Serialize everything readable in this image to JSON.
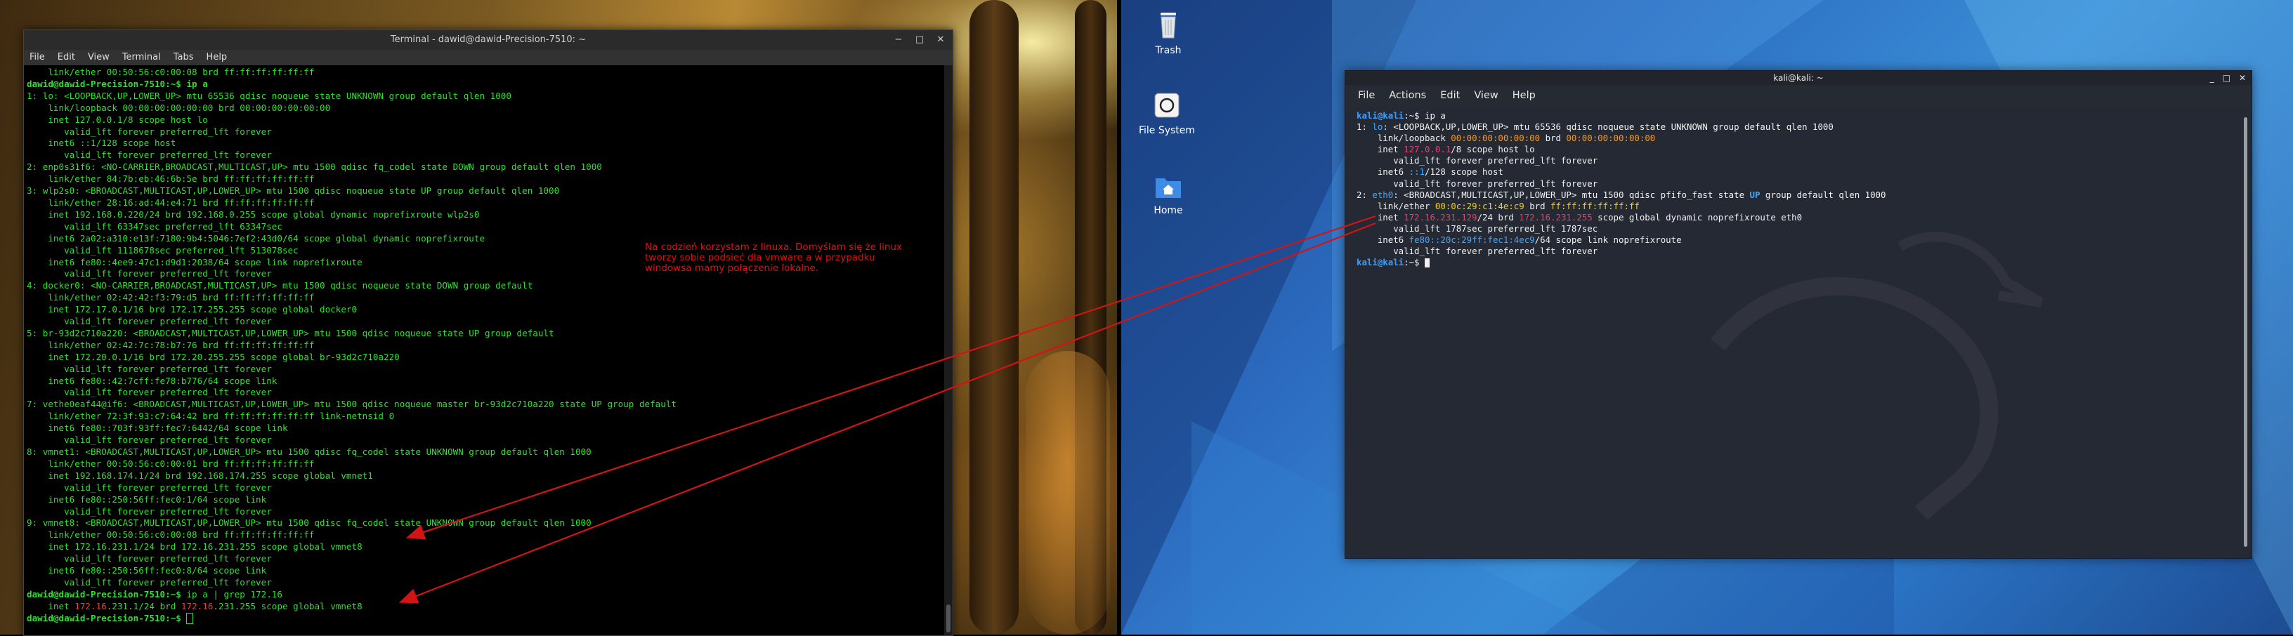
{
  "left_terminal": {
    "title": "Terminal - dawid@dawid-Precision-7510: ~",
    "window_buttons": [
      "−",
      "□",
      "✕"
    ],
    "menu": [
      "File",
      "Edit",
      "View",
      "Terminal",
      "Tabs",
      "Help"
    ],
    "lines": [
      "    link/ether 00:50:56:c0:00:08 brd ff:ff:ff:ff:ff:ff",
      "dawid@dawid-Precision-7510:~$ ip a",
      "1: lo: <LOOPBACK,UP,LOWER_UP> mtu 65536 qdisc noqueue state UNKNOWN group default qlen 1000",
      "    link/loopback 00:00:00:00:00:00 brd 00:00:00:00:00:00",
      "    inet 127.0.0.1/8 scope host lo",
      "       valid_lft forever preferred_lft forever",
      "    inet6 ::1/128 scope host",
      "       valid_lft forever preferred_lft forever",
      "2: enp0s31f6: <NO-CARRIER,BROADCAST,MULTICAST,UP> mtu 1500 qdisc fq_codel state DOWN group default qlen 1000",
      "    link/ether 84:7b:eb:46:6b:5e brd ff:ff:ff:ff:ff:ff",
      "3: wlp2s0: <BROADCAST,MULTICAST,UP,LOWER_UP> mtu 1500 qdisc noqueue state UP group default qlen 1000",
      "    link/ether 28:16:ad:44:e4:71 brd ff:ff:ff:ff:ff:ff",
      "    inet 192.168.0.220/24 brd 192.168.0.255 scope global dynamic noprefixroute wlp2s0",
      "       valid_lft 63347sec preferred_lft 63347sec",
      "    inet6 2a02:a310:e13f:7180:9b4:5046:7ef2:43d0/64 scope global dynamic noprefixroute",
      "       valid_lft 1118678sec preferred_lft 513078sec",
      "    inet6 fe80::4ee9:47c1:d9d1:2038/64 scope link noprefixroute",
      "       valid_lft forever preferred_lft forever",
      "4: docker0: <NO-CARRIER,BROADCAST,MULTICAST,UP> mtu 1500 qdisc noqueue state DOWN group default",
      "    link/ether 02:42:42:f3:79:d5 brd ff:ff:ff:ff:ff:ff",
      "    inet 172.17.0.1/16 brd 172.17.255.255 scope global docker0",
      "       valid_lft forever preferred_lft forever",
      "5: br-93d2c710a220: <BROADCAST,MULTICAST,UP,LOWER_UP> mtu 1500 qdisc noqueue state UP group default",
      "    link/ether 02:42:7c:78:b7:76 brd ff:ff:ff:ff:ff:ff",
      "    inet 172.20.0.1/16 brd 172.20.255.255 scope global br-93d2c710a220",
      "       valid_lft forever preferred_lft forever",
      "    inet6 fe80::42:7cff:fe78:b776/64 scope link",
      "       valid_lft forever preferred_lft forever",
      "7: vethe0eaf44@if6: <BROADCAST,MULTICAST,UP,LOWER_UP> mtu 1500 qdisc noqueue master br-93d2c710a220 state UP group default",
      "    link/ether 72:3f:93:c7:64:42 brd ff:ff:ff:ff:ff:ff link-netnsid 0",
      "    inet6 fe80::703f:93ff:fec7:6442/64 scope link",
      "       valid_lft forever preferred_lft forever",
      "8: vmnet1: <BROADCAST,MULTICAST,UP,LOWER_UP> mtu 1500 qdisc fq_codel state UNKNOWN group default qlen 1000",
      "    link/ether 00:50:56:c0:00:01 brd ff:ff:ff:ff:ff:ff",
      "    inet 192.168.174.1/24 brd 192.168.174.255 scope global vmnet1",
      "       valid_lft forever preferred_lft forever",
      "    inet6 fe80::250:56ff:fec0:1/64 scope link",
      "       valid_lft forever preferred_lft forever",
      "9: vmnet8: <BROADCAST,MULTICAST,UP,LOWER_UP> mtu 1500 qdisc fq_codel state UNKNOWN group default qlen 1000",
      "    link/ether 00:50:56:c0:00:08 brd ff:ff:ff:ff:ff:ff",
      "    inet 172.16.231.1/24 brd 172.16.231.255 scope global vmnet8",
      "       valid_lft forever preferred_lft forever",
      "    inet6 fe80::250:56ff:fec0:8/64 scope link",
      "       valid_lft forever preferred_lft forever"
    ],
    "grep_prompt": "dawid@dawid-Precision-7510:~$ ",
    "grep_command": "ip a | grep 172.16",
    "grep_result_pre": "    inet ",
    "grep_result_hl1": "172.16",
    "grep_result_mid": ".231.1/24 brd ",
    "grep_result_hl2": "172.16",
    "grep_result_post": ".231.255 scope global vmnet8",
    "final_prompt": "dawid@dawid-Precision-7510:~$ "
  },
  "annotation_note": "Na codzień korzystam z linuxa. Domyślam się że linux tworzy sobie podsieć dla vmware a w przypadku windowsa mamy połączenie lokalne.",
  "desktop_icons": [
    {
      "label": "Trash",
      "icon": "trash-icon"
    },
    {
      "label": "File System",
      "icon": "drive-icon"
    },
    {
      "label": "Home",
      "icon": "home-folder-icon"
    }
  ],
  "right_terminal": {
    "title": "kali@kali: ~",
    "window_buttons": [
      "_",
      "□",
      "✕"
    ],
    "menu": [
      "File",
      "Actions",
      "Edit",
      "View",
      "Help"
    ],
    "prompt_user": "kali@kali",
    "prompt_sep": ":~$ ",
    "command": "ip a",
    "lo_index": "1: ",
    "lo_name": "lo",
    "lo_header_rest": ": <LOOPBACK,UP,LOWER_UP> mtu 65536 qdisc noqueue state UNKNOWN group default qlen 1000",
    "lo_link_pre": "    link/loopback ",
    "lo_link_mac": "00:00:00:00:00:00",
    "lo_link_brd": " brd ",
    "lo_link_brdmac": "00:00:00:00:00:00",
    "lo_inet_pre": "    inet ",
    "lo_inet_ip": "127.0.0.1",
    "lo_inet_post": "/8 scope host lo",
    "lo_valid": "       valid_lft forever preferred_lft forever",
    "lo_inet6_pre": "    inet6 ",
    "lo_inet6_ip": "::1",
    "lo_inet6_post": "/128 scope host",
    "lo_valid6": "       valid_lft forever preferred_lft forever",
    "eth_index": "2: ",
    "eth_name": "eth0",
    "eth_header_mid": ": <BROADCAST,MULTICAST,UP,LOWER_UP> mtu 1500 qdisc pfifo_fast state ",
    "eth_state": "UP",
    "eth_header_rest": " group default qlen 1000",
    "eth_link_pre": "    link/ether ",
    "eth_link_mac": "00:0c:29:c1:4e:c9",
    "eth_link_brd": " brd ",
    "eth_link_brdmac": "ff:ff:ff:ff:ff:ff",
    "eth_inet_pre": "    inet ",
    "eth_inet_ip": "172.16.231.129",
    "eth_inet_mid": "/24 brd ",
    "eth_inet_brd": "172.16.231.255",
    "eth_inet_post": " scope global dynamic noprefixroute eth0",
    "eth_valid": "       valid_lft 1787sec preferred_lft 1787sec",
    "eth_inet6_pre": "    inet6 ",
    "eth_inet6_ip": "fe80::20c:29ff:fec1:4ec9",
    "eth_inet6_post": "/64 scope link noprefixroute",
    "eth_valid6": "       valid_lft forever preferred_lft forever"
  },
  "colors": {
    "annotation_red": "#e01010",
    "left_terminal_text": "#2fe02f",
    "kali_background": "#252933"
  }
}
